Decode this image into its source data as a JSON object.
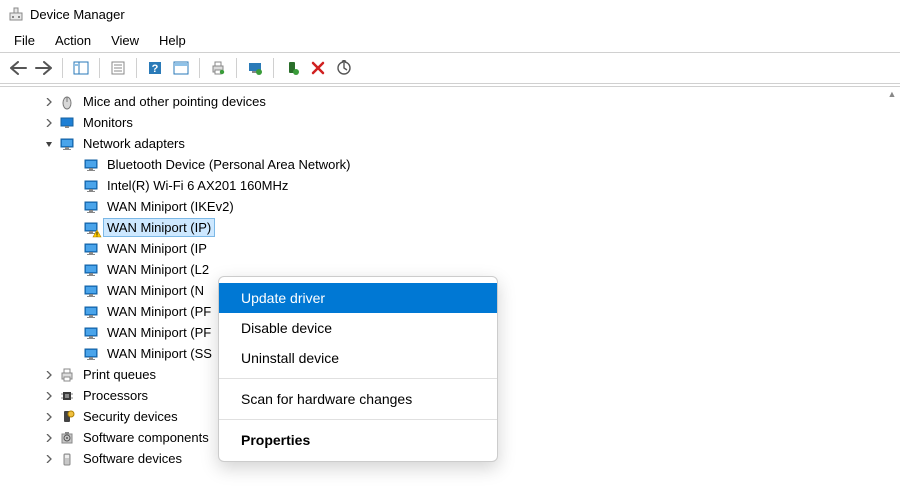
{
  "title": "Device Manager",
  "menubar": [
    "File",
    "Action",
    "View",
    "Help"
  ],
  "toolbar_icons": [
    "back-icon",
    "forward-icon",
    "sep",
    "show-hide-tree-icon",
    "sep",
    "properties-icon",
    "sep",
    "help-icon",
    "action-center-icon",
    "sep",
    "print-icon",
    "sep",
    "update-driver-icon",
    "sep",
    "uninstall-icon",
    "delete-icon",
    "scan-icon"
  ],
  "tree": [
    {
      "level": 1,
      "expander": "collapsed",
      "icon": "mouse",
      "label": "Mice and other pointing devices"
    },
    {
      "level": 1,
      "expander": "collapsed",
      "icon": "monitor",
      "label": "Monitors"
    },
    {
      "level": 1,
      "expander": "expanded",
      "icon": "network",
      "label": "Network adapters"
    },
    {
      "level": 2,
      "expander": "none",
      "icon": "network",
      "label": "Bluetooth Device (Personal Area Network)"
    },
    {
      "level": 2,
      "expander": "none",
      "icon": "network",
      "label": "Intel(R) Wi-Fi 6 AX201 160MHz"
    },
    {
      "level": 2,
      "expander": "none",
      "icon": "network",
      "label": "WAN Miniport (IKEv2)"
    },
    {
      "level": 2,
      "expander": "none",
      "icon": "network",
      "label": "WAN Miniport (IP)",
      "selected": true,
      "warn": true
    },
    {
      "level": 2,
      "expander": "none",
      "icon": "network",
      "label": "WAN Miniport (IP"
    },
    {
      "level": 2,
      "expander": "none",
      "icon": "network",
      "label": "WAN Miniport (L2"
    },
    {
      "level": 2,
      "expander": "none",
      "icon": "network",
      "label": "WAN Miniport (N"
    },
    {
      "level": 2,
      "expander": "none",
      "icon": "network",
      "label": "WAN Miniport (PF"
    },
    {
      "level": 2,
      "expander": "none",
      "icon": "network",
      "label": "WAN Miniport (PF"
    },
    {
      "level": 2,
      "expander": "none",
      "icon": "network",
      "label": "WAN Miniport (SS"
    },
    {
      "level": 1,
      "expander": "collapsed",
      "icon": "printer",
      "label": "Print queues"
    },
    {
      "level": 1,
      "expander": "collapsed",
      "icon": "cpu",
      "label": "Processors"
    },
    {
      "level": 1,
      "expander": "collapsed",
      "icon": "security",
      "label": "Security devices"
    },
    {
      "level": 1,
      "expander": "collapsed",
      "icon": "software",
      "label": "Software components"
    },
    {
      "level": 1,
      "expander": "collapsed",
      "icon": "softdev",
      "label": "Software devices"
    }
  ],
  "context_menu": {
    "items": [
      {
        "label": "Update driver",
        "hover": true
      },
      {
        "label": "Disable device"
      },
      {
        "label": "Uninstall device"
      },
      {
        "sep": true
      },
      {
        "label": "Scan for hardware changes"
      },
      {
        "sep": true
      },
      {
        "label": "Properties",
        "bold": true
      }
    ]
  }
}
